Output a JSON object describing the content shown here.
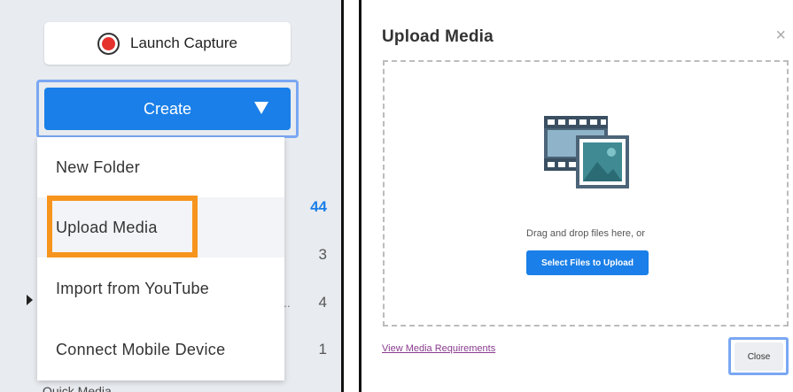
{
  "left": {
    "launch_capture_label": "Launch Capture",
    "create_label": "Create",
    "menu_items": [
      {
        "label": "New Folder"
      },
      {
        "label": "Upload Media"
      },
      {
        "label": "Import from YouTube"
      },
      {
        "label": "Connect Mobile Device"
      }
    ],
    "counts": [
      "44",
      "3",
      "4",
      "1"
    ],
    "ellipsis": "..",
    "folder_peek": "Quick Media"
  },
  "dialog": {
    "title": "Upload Media",
    "close_symbol": "×",
    "drop_text": "Drag and drop files here, or",
    "select_button": "Select Files to Upload",
    "requirements_link": "View Media Requirements",
    "close_button": "Close"
  },
  "colors": {
    "accent_blue": "#1a7fe8",
    "highlight_orange": "#f7941d",
    "record_red": "#e5322d",
    "link_purple": "#8a3c90"
  },
  "icons": [
    "record-icon",
    "caret-down-icon",
    "expand-arrow-icon",
    "media-film-image-icon",
    "close-icon"
  ]
}
